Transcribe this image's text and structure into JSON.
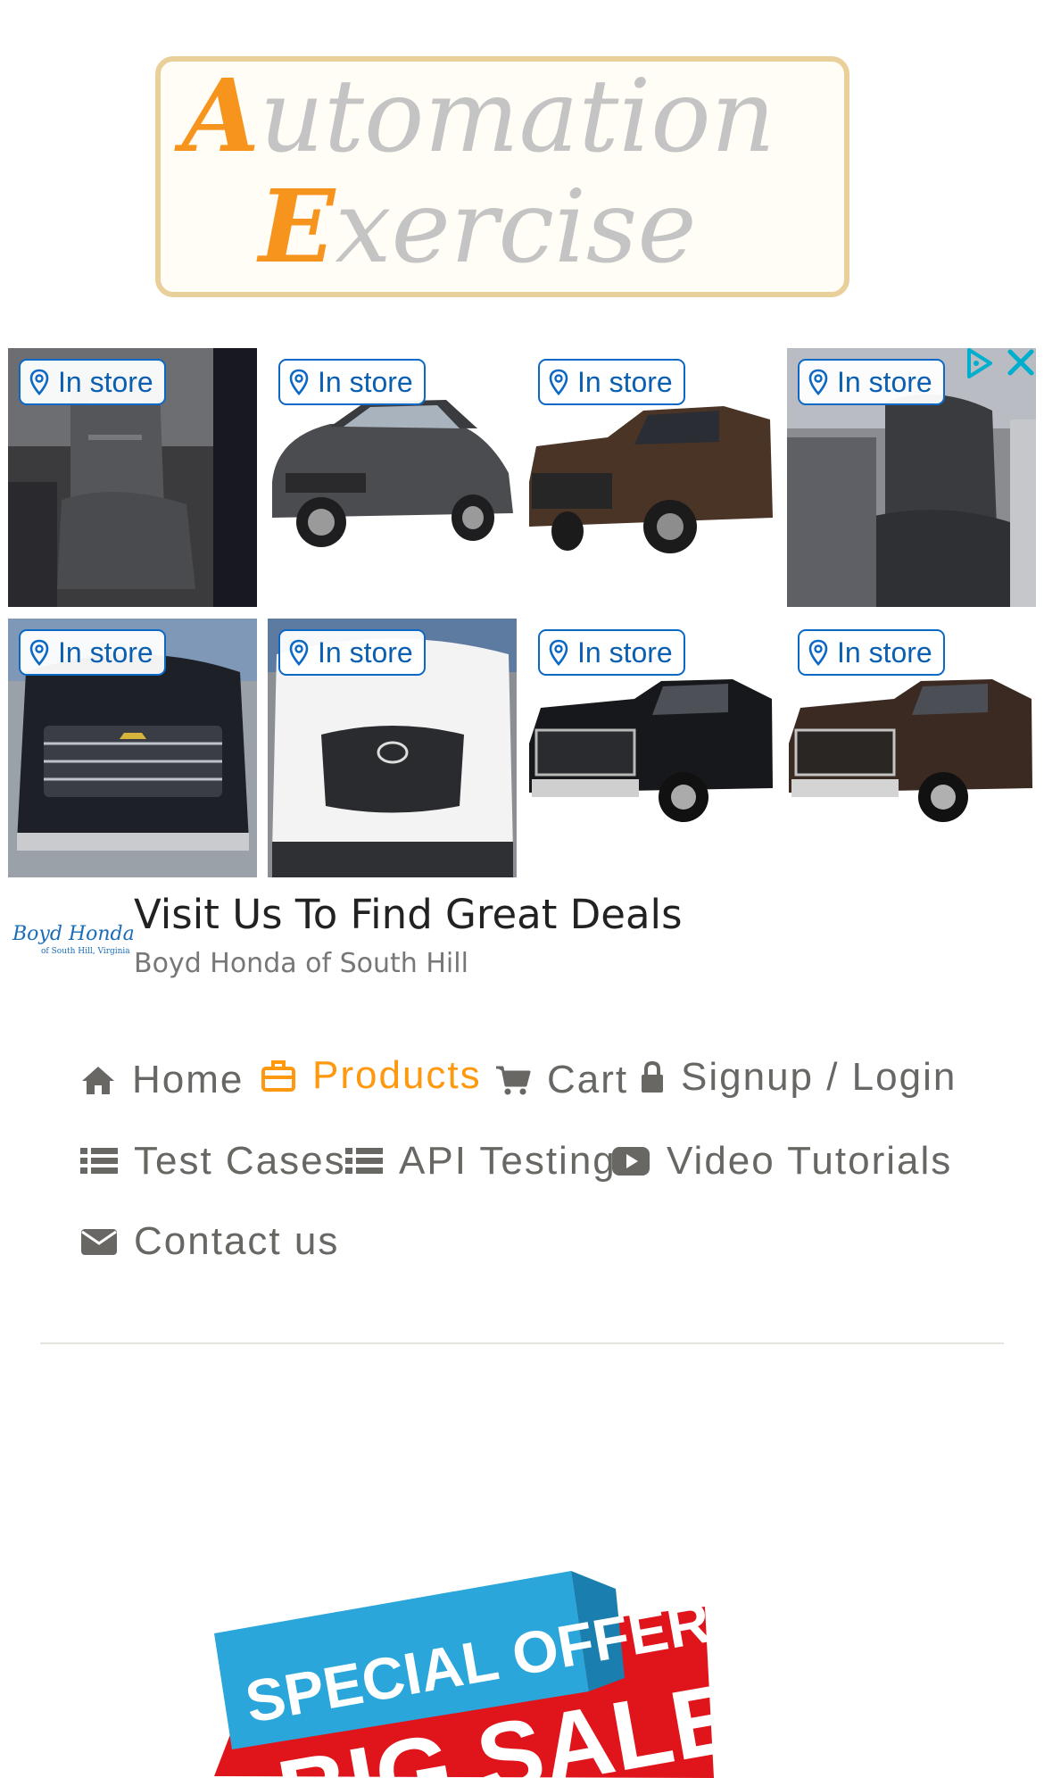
{
  "logo": {
    "line1_cap": "A",
    "line1_rest": "utomation",
    "line2_cap": "E",
    "line2_rest": "xercise"
  },
  "ad": {
    "badge_text": "In store",
    "tiles": [
      {
        "name": "Interior seats"
      },
      {
        "name": "Gray SUV"
      },
      {
        "name": "Brown pickup"
      },
      {
        "name": "Interior seats silver"
      },
      {
        "name": "Black pickup front"
      },
      {
        "name": "White pickup front"
      },
      {
        "name": "Black RAM pickup"
      },
      {
        "name": "Brown RAM pickup"
      }
    ],
    "headline": "Visit Us To Find Great Deals",
    "advertiser": "Boyd Honda of South Hill",
    "advertiser_logo_text": "Boyd Honda",
    "advertiser_logo_sub": "of South Hill, Virginia",
    "colors": {
      "badge": "#0b68c4",
      "adchoices": "#00aecd"
    }
  },
  "nav": {
    "home": "Home",
    "products": "Products",
    "cart": "Cart",
    "signup": "Signup / Login",
    "test_cases": "Test Cases",
    "api_testing": "API Testing",
    "video_tutorials": "Video Tutorials",
    "contact": "Contact us",
    "active": "Products",
    "colors": {
      "default": "#696763",
      "active": "#fe980f"
    }
  },
  "banner": {
    "top_text": "SPECIAL OFFER",
    "bottom_text": "BIG SALE"
  }
}
